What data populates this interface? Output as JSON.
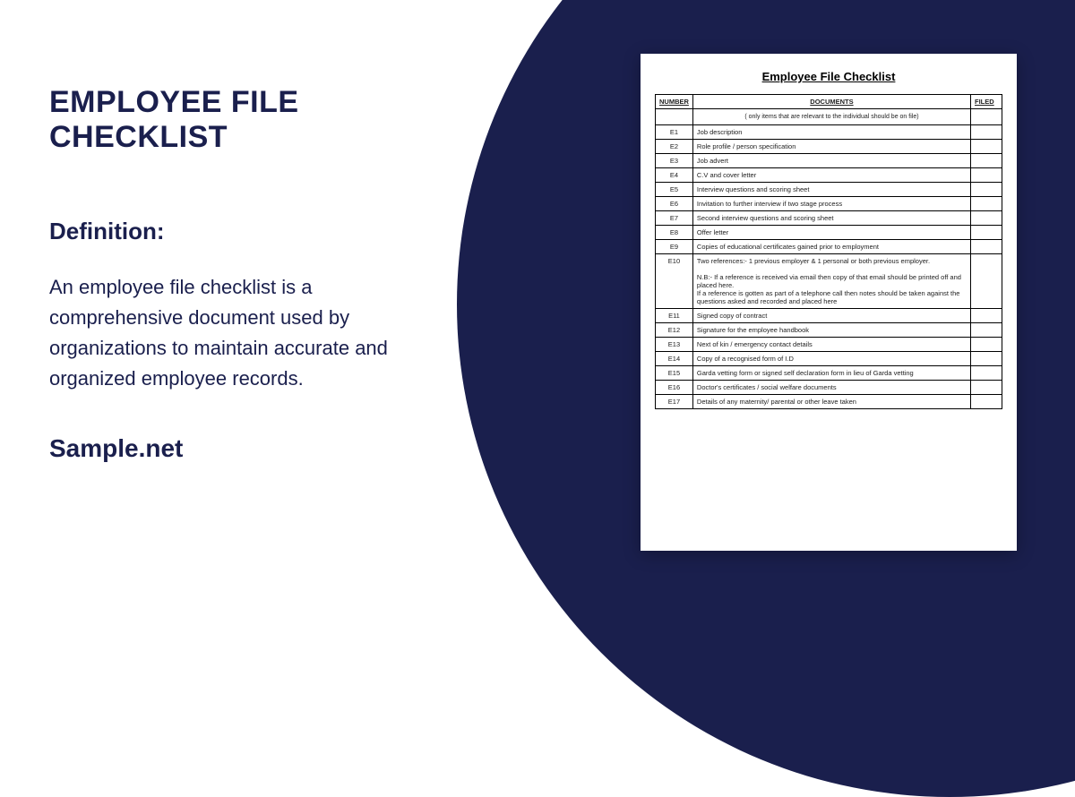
{
  "title": "EMPLOYEE FILE CHECKLIST",
  "definition_label": "Definition:",
  "definition_text": "An employee file checklist is a comprehensive document used by organizations to maintain accurate and organized employee records.",
  "brand": "Sample.net",
  "doc": {
    "title": "Employee File Checklist",
    "headers": {
      "number": "NUMBER",
      "documents": "DOCUMENTS",
      "filed": "FILED"
    },
    "note": "( only items that are relevant to the individual should be on file)",
    "rows": [
      {
        "num": "E1",
        "text": "Job description"
      },
      {
        "num": "E2",
        "text": "Role profile / person specification"
      },
      {
        "num": "E3",
        "text": "Job advert"
      },
      {
        "num": "E4",
        "text": "C.V and cover letter"
      },
      {
        "num": "E5",
        "text": "Interview questions and scoring sheet"
      },
      {
        "num": "E6",
        "text": "Invitation to further interview if two stage process"
      },
      {
        "num": "E7",
        "text": "Second interview questions and scoring sheet"
      },
      {
        "num": "E8",
        "text": "Offer letter"
      },
      {
        "num": "E9",
        "text": "Copies of educational certificates gained prior to employment"
      },
      {
        "num": "E10",
        "text": "Two references:- 1 previous employer & 1 personal or both previous employer.\n\nN.B:- If a reference is received via email then copy of that email should be printed off and placed here.\nIf a reference is gotten as part of a telephone call then notes should be taken against the questions asked and recorded and placed here"
      },
      {
        "num": "E11",
        "text": "Signed copy of contract"
      },
      {
        "num": "E12",
        "text": "Signature for the employee handbook"
      },
      {
        "num": "E13",
        "text": "Next of kin / emergency contact details"
      },
      {
        "num": "E14",
        "text": "Copy of a recognised form of I.D"
      },
      {
        "num": "E15",
        "text": "Garda vetting form or signed self declaration form in lieu of Garda vetting"
      },
      {
        "num": "E16",
        "text": "Doctor's certificates / social welfare documents"
      },
      {
        "num": "E17",
        "text": "Details of any maternity/ parental or other leave taken"
      }
    ]
  }
}
